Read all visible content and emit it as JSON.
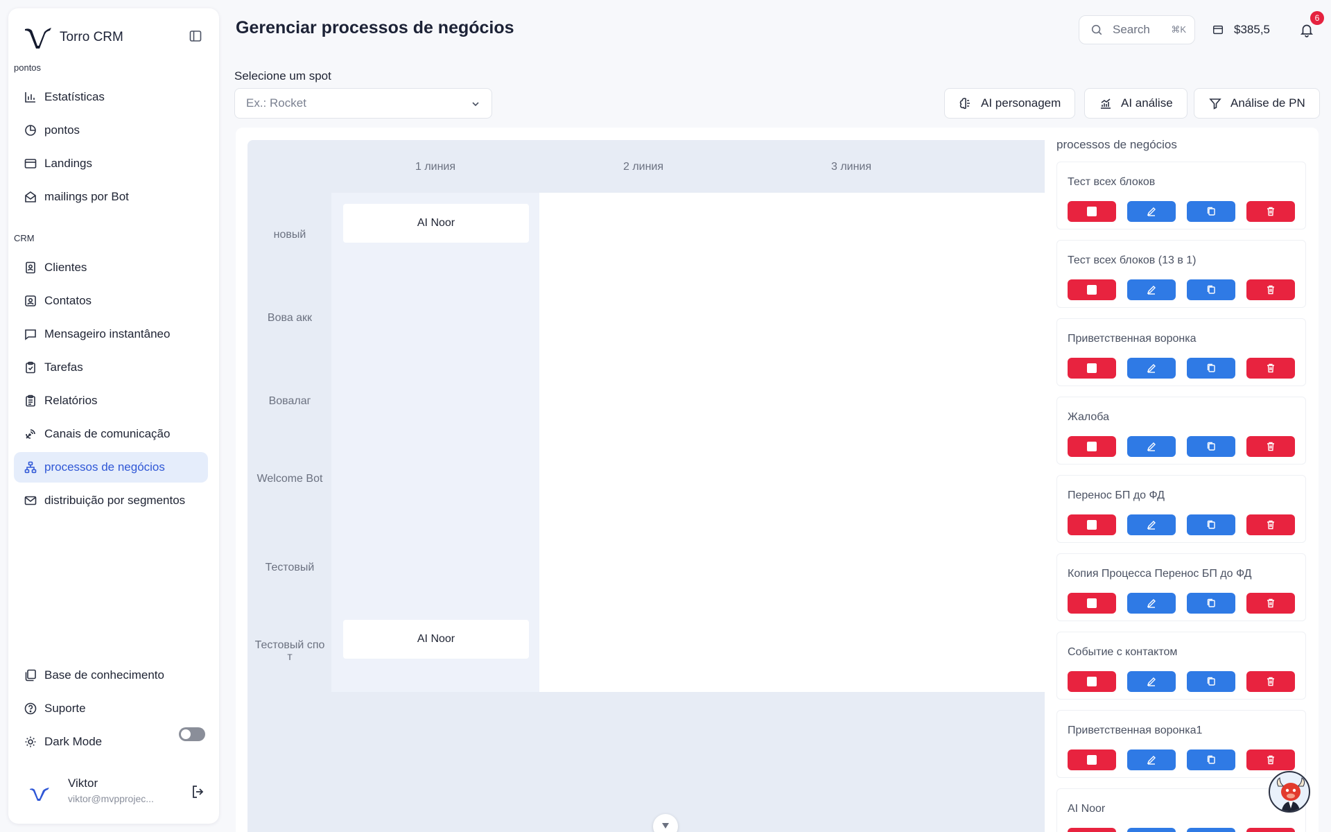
{
  "brand": {
    "name": "Torro CRM"
  },
  "sidebar": {
    "section_pontos": "pontos",
    "section_crm": "CRM",
    "items_top": [
      {
        "label": "Estatísticas",
        "icon": "bar-chart-icon"
      },
      {
        "label": "pontos",
        "icon": "pie-chart-icon"
      },
      {
        "label": "Landings",
        "icon": "browser-window-icon"
      },
      {
        "label": "mailings por Bot",
        "icon": "mail-open-icon"
      }
    ],
    "items_crm": [
      {
        "label": "Clientes",
        "icon": "contact-book-icon"
      },
      {
        "label": "Contatos",
        "icon": "contact-card-icon"
      },
      {
        "label": "Mensageiro instantâneo",
        "icon": "message-square-icon"
      },
      {
        "label": "Tarefas",
        "icon": "clipboard-check-icon"
      },
      {
        "label": "Relatórios",
        "icon": "clipboard-list-icon"
      },
      {
        "label": "Canais de comunicação",
        "icon": "satellite-dish-icon"
      },
      {
        "label": "processos de negócios",
        "icon": "hierarchy-icon",
        "active": true
      },
      {
        "label": "distribuição por segmentos",
        "icon": "mail-icon"
      }
    ],
    "items_bottom": [
      {
        "label": "Base de conhecimento",
        "icon": "library-icon"
      },
      {
        "label": "Suporte",
        "icon": "help-circle-icon"
      },
      {
        "label": "Dark Mode",
        "icon": "sun-icon"
      }
    ],
    "user": {
      "name": "Viktor",
      "email": "viktor@mvpprojec..."
    }
  },
  "header": {
    "title": "Gerenciar processos de negócios",
    "search_label": "Search",
    "search_shortcut": "⌘K",
    "balance": "$385,5",
    "notifications_count": "6"
  },
  "spot": {
    "label": "Selecione um spot",
    "placeholder": "Ex.: Rocket"
  },
  "actions": {
    "ai_persona": "AI personagem",
    "ai_analysis": "AI análise",
    "pn_analysis": "Análise de PN"
  },
  "board": {
    "columns": [
      "1 линия",
      "2 линия",
      "3 линия"
    ],
    "rows": [
      "новый",
      "Вова акк",
      "Вовалаг",
      "Welcome Bot",
      "Тестовый",
      "Тестовый спот"
    ],
    "cards": [
      {
        "row": 0,
        "col": 0,
        "label": "AI Noor"
      },
      {
        "row": 5,
        "col": 0,
        "label": "AI Noor"
      }
    ]
  },
  "processes": {
    "title": "processos de negócios",
    "items": [
      "Тест всех блоков",
      "Тест всех блоков (13 в 1)",
      "Приветственная воронка",
      "Жалоба",
      "Перенос БП до ФД",
      "Копия Процесса Перенос БП до ФД",
      "Событие с контактом",
      "Приветственная воронка1",
      "AI Noor"
    ]
  },
  "colors": {
    "accent": "#2f57d6",
    "danger": "#e8233f",
    "primary_button": "#2f7ae5",
    "board_bg": "#e7ecf5"
  }
}
